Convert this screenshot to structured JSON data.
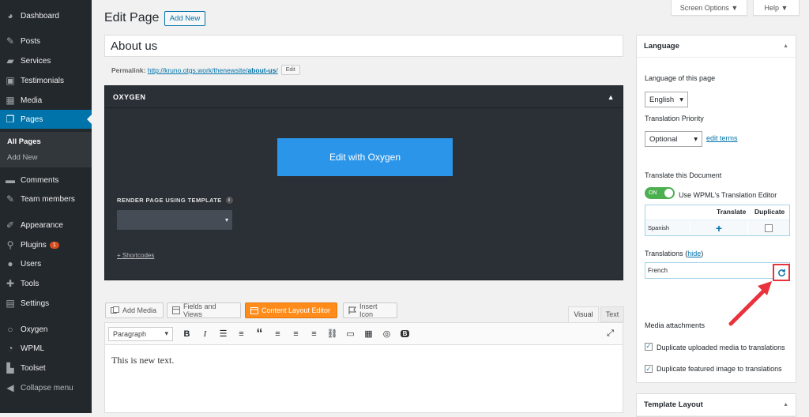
{
  "sidebar": {
    "items": [
      {
        "label": "Dashboard",
        "icon": "dashboard-icon"
      },
      {
        "label": "Posts",
        "icon": "pin-icon"
      },
      {
        "label": "Services",
        "icon": "folder-icon"
      },
      {
        "label": "Testimonials",
        "icon": "testimonial-icon"
      },
      {
        "label": "Media",
        "icon": "media-icon"
      },
      {
        "label": "Pages",
        "icon": "pages-icon"
      },
      {
        "label": "Comments",
        "icon": "comment-icon"
      },
      {
        "label": "Team members",
        "icon": "pin-icon"
      },
      {
        "label": "Appearance",
        "icon": "brush-icon"
      },
      {
        "label": "Plugins",
        "icon": "plugin-icon",
        "badge": "1"
      },
      {
        "label": "Users",
        "icon": "user-icon"
      },
      {
        "label": "Tools",
        "icon": "wrench-icon"
      },
      {
        "label": "Settings",
        "icon": "settings-icon"
      },
      {
        "label": "Oxygen",
        "icon": "oxygen-icon"
      },
      {
        "label": "WPML",
        "icon": "wpml-icon"
      },
      {
        "label": "Toolset",
        "icon": "toolset-icon"
      },
      {
        "label": "Collapse menu",
        "icon": "collapse-icon"
      }
    ],
    "submenu": [
      "All Pages",
      "Add New"
    ]
  },
  "header": {
    "screen_options": "Screen Options",
    "help": "Help",
    "title": "Edit Page",
    "add_new": "Add New"
  },
  "post": {
    "title": "About us",
    "permalink_label": "Permalink:",
    "permalink_url": "http://kruno.otgs.work/thenewsite/",
    "permalink_slug": "about-us",
    "permalink_suffix": "/",
    "edit_btn": "Edit"
  },
  "oxygen": {
    "heading": "OXYGEN",
    "edit_btn": "Edit with Oxygen",
    "render_label": "RENDER PAGE USING TEMPLATE",
    "info": "i",
    "shortcodes": "+ Shortcodes"
  },
  "editor": {
    "buttons": [
      "Add Media",
      "Fields and Views",
      "Content Layout Editor",
      "Insert Icon"
    ],
    "tabs": [
      "Visual",
      "Text"
    ],
    "format": "Paragraph",
    "content": "This is new text.",
    "bold": "B",
    "italic": "I",
    "quote": "“"
  },
  "language": {
    "heading": "Language",
    "page_lang_label": "Language of this page",
    "page_lang": "English",
    "priority_label": "Translation Priority",
    "priority": "Optional",
    "edit_terms": "edit terms",
    "translate_doc": "Translate this Document",
    "toggle": "ON",
    "wpml_editor": "Use WPML's Translation Editor",
    "col_translate": "Translate",
    "col_duplicate": "Duplicate",
    "row_lang": "Spanish",
    "translations_label": "Translations",
    "hide": "hide",
    "french": "French",
    "media_heading": "Media attachments",
    "dup_media": "Duplicate uploaded media to translations",
    "dup_featured": "Duplicate featured image to translations"
  },
  "template_box": {
    "heading": "Template Layout"
  },
  "colors": {
    "accent": "#0073aa",
    "annotation": "#e8323c",
    "oxygen_button": "#2b95ea",
    "orange": "#ff8c1a"
  }
}
